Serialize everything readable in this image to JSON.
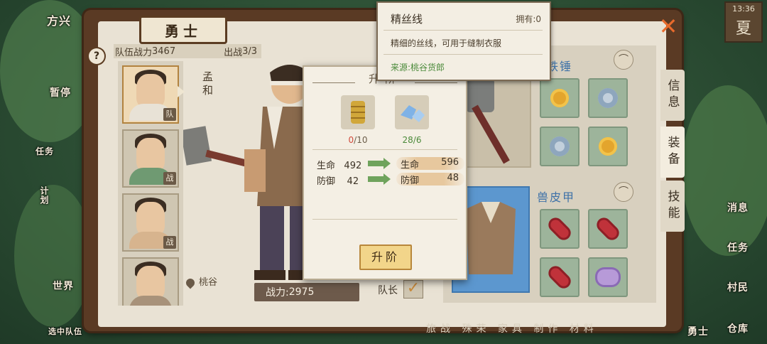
{
  "map_left": {
    "labels": [
      "方兴",
      "暂停",
      "任务",
      "计划",
      "世界",
      "选中队伍"
    ]
  },
  "map_right": {
    "labels": [
      "消息",
      "任务",
      "村民",
      "勇士",
      "仓库"
    ]
  },
  "clock": {
    "time": "13:36",
    "season": "夏"
  },
  "window": {
    "title": "勇士"
  },
  "team": {
    "power_label": "队伍战力",
    "power_value": "3467",
    "deploy_label": "出战",
    "deploy_value": "3/3"
  },
  "roster": [
    {
      "tag": "队",
      "selected": true,
      "body_color": "#e8e2d6"
    },
    {
      "tag": "战",
      "selected": false,
      "body_color": "#6f9a72"
    },
    {
      "tag": "战",
      "selected": false,
      "body_color": "#d7b48e"
    },
    {
      "tag": "",
      "selected": false,
      "body_color": "#a8927a"
    }
  ],
  "hero": {
    "name": "孟和",
    "location": "桃谷",
    "power_label": "战力:",
    "power_value": "2975",
    "captain_label": "队长",
    "captain_check": "✓"
  },
  "upgrade_popup": {
    "title": "升阶",
    "materials": [
      {
        "icon": "silk-thread-icon",
        "qty_have": "0",
        "qty_need": "/10",
        "have_color": "#d04a3c"
      },
      {
        "icon": "blue-crystal-icon",
        "qty_have": "28",
        "qty_need": "/6",
        "have_color": "#4b8a3a"
      }
    ],
    "stats": [
      {
        "label": "生命",
        "before": "492",
        "after_label": "生命",
        "after": "596"
      },
      {
        "label": "防御",
        "before": "42",
        "after_label": "防御",
        "after": "48"
      }
    ],
    "button": "升阶"
  },
  "equipment": {
    "weapon_name": "铁锤",
    "armor_name": "兽皮甲",
    "weapon_mats": [
      "coin-icon",
      "gear-icon",
      "gear-icon",
      "coin-icon"
    ],
    "armor_mats": [
      "bead-icon",
      "bead-icon",
      "bead-icon",
      "purple-icon"
    ]
  },
  "tabs": [
    "信息",
    "装备",
    "技能"
  ],
  "active_tab": 1,
  "tooltip": {
    "name": "精丝线",
    "own_label": "拥有:",
    "own_value": "0",
    "desc": "精细的丝线，可用于缝制衣服",
    "source": "来源:桃谷货郎"
  },
  "bottom_labels": "旅战 殊荣 家具 制作 材料",
  "colors": {
    "accent": "#e86a2c",
    "frame": "#5a3a24",
    "panel": "#e9e2d4",
    "armor_slot": "#5c97cf"
  }
}
